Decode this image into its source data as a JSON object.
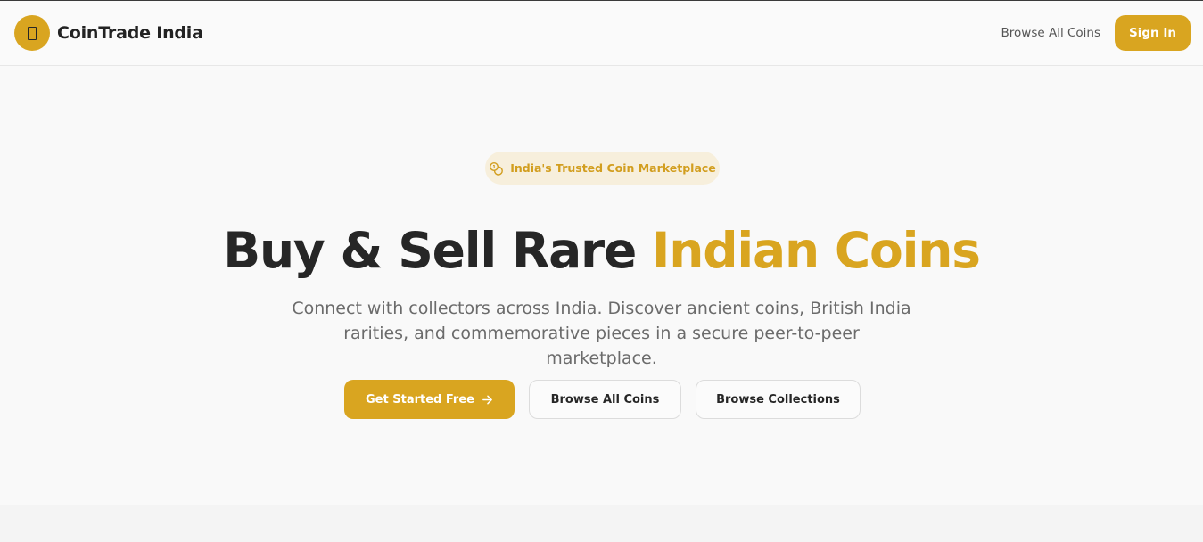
{
  "brand": {
    "name": "CoinTrade India",
    "logo_icon": "coin-icon"
  },
  "nav": {
    "browse_label": "Browse All Coins",
    "signin_label": "Sign In"
  },
  "hero": {
    "badge": {
      "label": "India's Trusted Coin Marketplace",
      "icon": "coins-icon"
    },
    "title_prefix": "Buy & Sell Rare ",
    "title_accent": "Indian Coins",
    "subtitle": "Connect with collectors across India. Discover ancient coins, British India rarities, and commemorative pieces in a secure peer-to-peer marketplace.",
    "buttons": {
      "primary": "Get Started Free",
      "browse_coins": "Browse All Coins",
      "browse_collections": "Browse Collections"
    }
  },
  "colors": {
    "accent": "#d9a520",
    "badge_bg": "#f7efdc",
    "text": "#262626",
    "muted": "#6b6b6b"
  }
}
